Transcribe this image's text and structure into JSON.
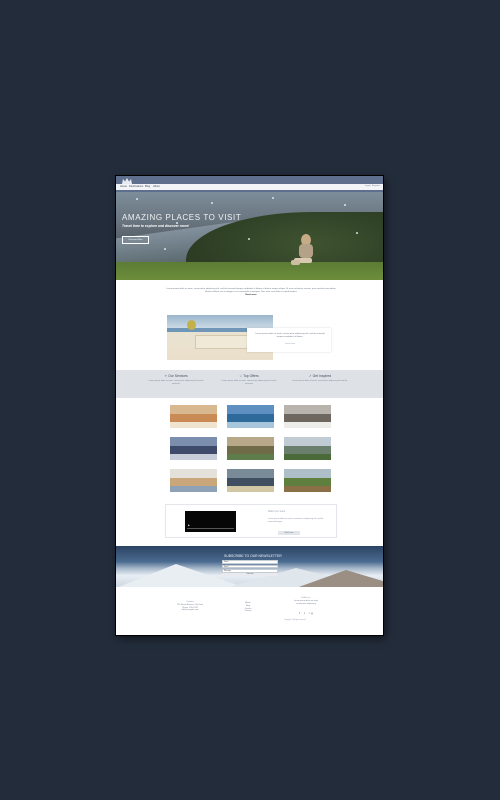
{
  "site": {
    "logo_text": "COLLECTIVE"
  },
  "nav": {
    "items": [
      "Home",
      "Destinations",
      "Blog",
      "About"
    ],
    "right_text": "Login | Register"
  },
  "hero": {
    "title": "AMAZING PLACES TO VISIT",
    "subtitle": "Travel time to explore and discover more!",
    "button": "Discover More"
  },
  "intro": {
    "text": "Lorem ipsum dolor sit amet, consectetur adipiscing elit, sed do eiusmod tempor incididunt ut labore et dolore magna aliqua. Ut enim ad minim veniam, quis nostrud exercitation ullamco laboris nisi ut aliquip ex ea commodo consequat. Duis aute irure dolor in reprehenderit.",
    "link": "Read more"
  },
  "feature": {
    "text": "Lorem ipsum dolor sit amet, consectetur adipiscing elit, sed do eiusmod tempor incididunt ut labore.",
    "link": "Learn more"
  },
  "columns": [
    {
      "icon": "compass-icon",
      "title": "Our Services",
      "text": "Lorem ipsum dolor sit amet, consectetur adipiscing elit sed do eiusmod."
    },
    {
      "icon": "star-icon",
      "title": "Top Offers",
      "text": "Lorem ipsum dolor sit amet, consectetur adipiscing elit sed do eiusmod."
    },
    {
      "icon": "check-icon",
      "title": "Get Inspired",
      "text": "Lorem ipsum dolor sit amet, consectetur adipiscing elit sed do."
    }
  ],
  "gallery": [
    {
      "label": "",
      "colors": [
        "#d7b88f",
        "#c98a55",
        "#efe4d0"
      ]
    },
    {
      "label": "",
      "colors": [
        "#5d90c0",
        "#2f6a9c",
        "#a7c6dc"
      ]
    },
    {
      "label": "",
      "colors": [
        "#b8b3ad",
        "#6e675f",
        "#ecece9"
      ]
    },
    {
      "label": "",
      "colors": [
        "#7c8ead",
        "#3d4a6a",
        "#c7cdd8"
      ]
    },
    {
      "label": "",
      "colors": [
        "#b6a888",
        "#6f6a47",
        "#5f7d4b"
      ]
    },
    {
      "label": "",
      "colors": [
        "#c0cbd4",
        "#6b7f6d",
        "#4a6a3a"
      ]
    },
    {
      "label": "",
      "colors": [
        "#e4e1db",
        "#caa77b",
        "#8ea1b6"
      ]
    },
    {
      "label": "",
      "colors": [
        "#7a8b98",
        "#3f4f5f",
        "#d2c7a4"
      ]
    },
    {
      "label": "",
      "colors": [
        "#aebfca",
        "#5e7f3d",
        "#8a6f47"
      ]
    }
  ],
  "video_card": {
    "title": "Watch our video",
    "text": "Lorem ipsum dolor sit amet, consectetur adipiscing elit, sed do eiusmod tempor.",
    "button": "Watch now"
  },
  "newsletter": {
    "title": "SUBSCRIBE TO OUR NEWSLETTER",
    "name_placeholder": "Name",
    "email_placeholder": "Email",
    "message_placeholder": "Message",
    "button": "Subscribe"
  },
  "footer": {
    "col1_head": "Contact",
    "col1_lines": [
      "123 Street Avenue, City Town",
      "Phone: 555-1234",
      "info@example.com"
    ],
    "col2_lines": [
      "About",
      "Blog",
      "Contact",
      "Privacy"
    ],
    "col3_head": "Follow us",
    "col3_lines": [
      "Lorem ipsum dolor sit amet",
      "consectetur adipiscing"
    ],
    "social": "f t ig",
    "copyright": "Copyright © All rights reserved"
  }
}
